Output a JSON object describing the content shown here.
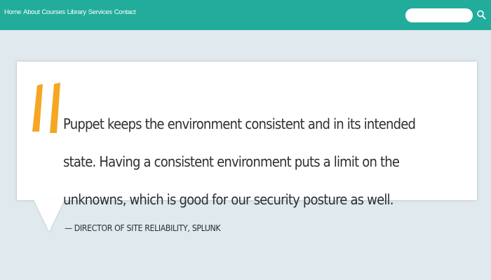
{
  "nav": {
    "links": [
      "Home",
      "About",
      "Courses",
      "Library",
      "Services",
      "Contact"
    ]
  },
  "search": {
    "placeholder": "",
    "value": "",
    "icon": "search-icon"
  },
  "quote": {
    "text": "Puppet keeps the environment consistent and in its intended state. Having a consistent environment puts a limit on the unknowns, which is good for our security posture as well.",
    "attribution": "— DIRECTOR OF SITE RELIABILITY, SPLUNK",
    "mark_icon": "quote-mark-icon"
  },
  "colors": {
    "header": "#22ac9c",
    "page_background": "#e0e9ee",
    "quote_mark": "#f5a623",
    "text": "#2b2f33"
  }
}
